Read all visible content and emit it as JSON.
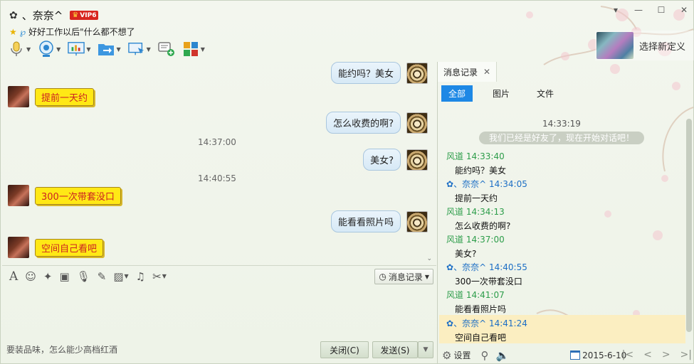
{
  "contact": {
    "nickname": "、奈奈^",
    "vip_label": "VIP6",
    "status_message": "好好工作以后\"什么都不想了"
  },
  "theme": {
    "label": "选择新定义"
  },
  "chat": {
    "messages": [
      {
        "from": "me",
        "text": "能约吗？美女"
      },
      {
        "from": "other",
        "text": "提前一天约"
      },
      {
        "from": "me",
        "text": "怎么收费的啊?"
      },
      {
        "from": "ts",
        "text": "14:37:00"
      },
      {
        "from": "me",
        "text": "美女?"
      },
      {
        "from": "ts",
        "text": "14:40:55"
      },
      {
        "from": "other",
        "text": "300一次带套没口"
      },
      {
        "from": "me",
        "text": "能看看照片吗"
      },
      {
        "from": "other",
        "text": "空间自己看吧"
      }
    ]
  },
  "input": {
    "history_button": "消息记录",
    "signature": "要装品味，怎么能少高档红酒",
    "close_button": "关闭(C)",
    "send_button": "发送(S)"
  },
  "history": {
    "tab_label": "消息记录",
    "filters": [
      "全部",
      "图片",
      "文件"
    ],
    "first_time": "14:33:19",
    "system_notice": "我们已经是好友了，现在开始对话吧！",
    "entries": [
      {
        "who": "me",
        "name": "风道",
        "time": "14:33:40",
        "text": "能约吗？美女"
      },
      {
        "who": "other",
        "name": "、奈奈^",
        "time": "14:34:05",
        "text": "提前一天约"
      },
      {
        "who": "me",
        "name": "风道",
        "time": "14:34:13",
        "text": "怎么收费的啊?"
      },
      {
        "who": "me",
        "name": "风道",
        "time": "14:37:00",
        "text": "美女?"
      },
      {
        "who": "other",
        "name": "、奈奈^",
        "time": "14:40:55",
        "text": "300一次带套没口"
      },
      {
        "who": "me",
        "name": "风道",
        "time": "14:41:07",
        "text": "能看看照片吗"
      },
      {
        "who": "other",
        "name": "、奈奈^",
        "time": "14:41:24",
        "text": "空间自己看吧"
      }
    ],
    "settings_label": "设置",
    "date": "2015-6-10"
  },
  "colors": {
    "accent_blue": "#1e88e5",
    "me_name_green": "#2d9d4a",
    "other_name_blue": "#1c6ec5",
    "yellow_bubble": "#ffe815",
    "red_text": "#cc2222",
    "highlight": "#fbeec1"
  }
}
